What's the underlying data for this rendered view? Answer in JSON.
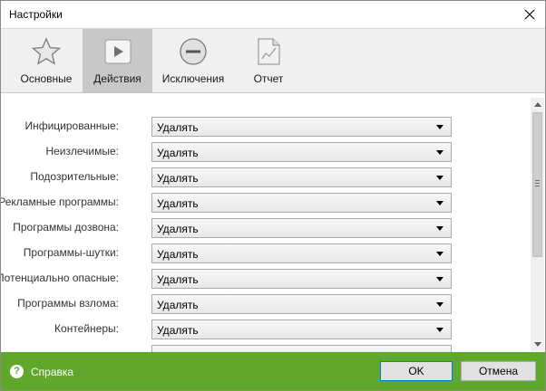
{
  "window": {
    "title": "Настройки"
  },
  "tabs": [
    {
      "label": "Основные",
      "icon": "star-icon",
      "active": false
    },
    {
      "label": "Действия",
      "icon": "play-icon",
      "active": true
    },
    {
      "label": "Исключения",
      "icon": "minus-circle-icon",
      "active": false
    },
    {
      "label": "Отчет",
      "icon": "report-chart-icon",
      "active": false
    }
  ],
  "rows": [
    {
      "label": "Инфицированные:",
      "value": "Удалять"
    },
    {
      "label": "Неизлечимые:",
      "value": "Удалять"
    },
    {
      "label": "Подозрительные:",
      "value": "Удалять"
    },
    {
      "label": "Рекламные программы:",
      "value": "Удалять"
    },
    {
      "label": "Программы дозвона:",
      "value": "Удалять"
    },
    {
      "label": "Программы-шутки:",
      "value": "Удалять"
    },
    {
      "label": "Потенциально опасные:",
      "value": "Удалять"
    },
    {
      "label": "Программы взлома:",
      "value": "Удалять"
    },
    {
      "label": "Контейнеры:",
      "value": "Удалять"
    }
  ],
  "footer": {
    "help_label": "Справка",
    "help_glyph": "?",
    "ok_label": "OK",
    "cancel_label": "Отмена"
  },
  "colors": {
    "footer_bg": "#5fa82b",
    "active_tab_bg": "#c8c8c8",
    "toolbar_bg": "#f0f0f0"
  }
}
